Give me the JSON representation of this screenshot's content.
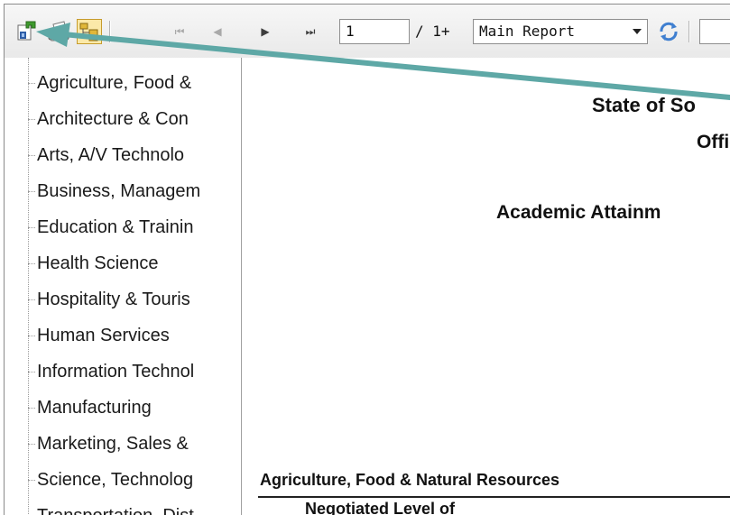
{
  "toolbar": {
    "export_icon": "export-icon",
    "print_icon": "print-icon",
    "group_tree_icon": "group-tree-toggle-icon",
    "nav": {
      "first": "⏮",
      "prev": "◀",
      "next": "▶",
      "last": "⏭"
    },
    "page_number": "1",
    "page_total": "/ 1+",
    "report_select": "Main Report",
    "refresh_icon": "refresh-icon"
  },
  "group_tree": {
    "items": [
      "Agriculture, Food &",
      "Architecture & Con",
      "Arts, A/V Technolo",
      "Business, Managem",
      "Education & Trainin",
      "Health Science",
      "Hospitality & Touris",
      "Human Services",
      "Information Technol",
      "Manufacturing",
      "Marketing, Sales &",
      "Science, Technolog",
      "Transportation, Dist"
    ]
  },
  "report": {
    "title_line1": "State of So",
    "title_line2": "Offic",
    "title_line3": "Academic Attainm",
    "section_heading": "Agriculture, Food & Natural Resources",
    "column_heading": "Negotiated Level of"
  },
  "annotation": {
    "arrow_color": "#5ea8a6"
  }
}
